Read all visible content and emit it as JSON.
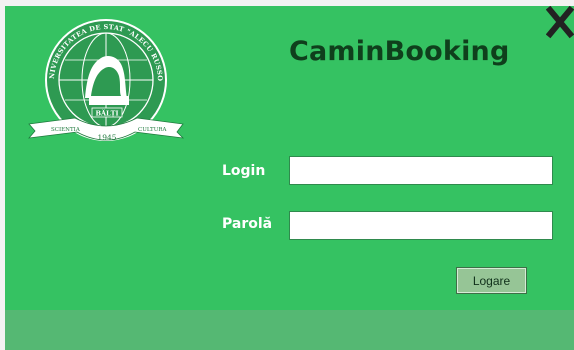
{
  "app": {
    "title": "CaminBooking"
  },
  "logo": {
    "top_arc_text": "UNIVERSITATEA DE STAT \"ALECU RUSSO\"",
    "city": "BĂLȚI",
    "ribbon_left": "SCIENTIA",
    "ribbon_right": "CULTURA",
    "year": "1945"
  },
  "form": {
    "login_label": "Login",
    "login_value": "",
    "password_label": "Parolă",
    "password_value": "",
    "submit_label": "Logare"
  },
  "icons": {
    "close": "close-icon"
  },
  "colors": {
    "background": "#35c262",
    "footer_band": "#55b873",
    "title": "#0f3f1c",
    "button": "#96c596"
  }
}
